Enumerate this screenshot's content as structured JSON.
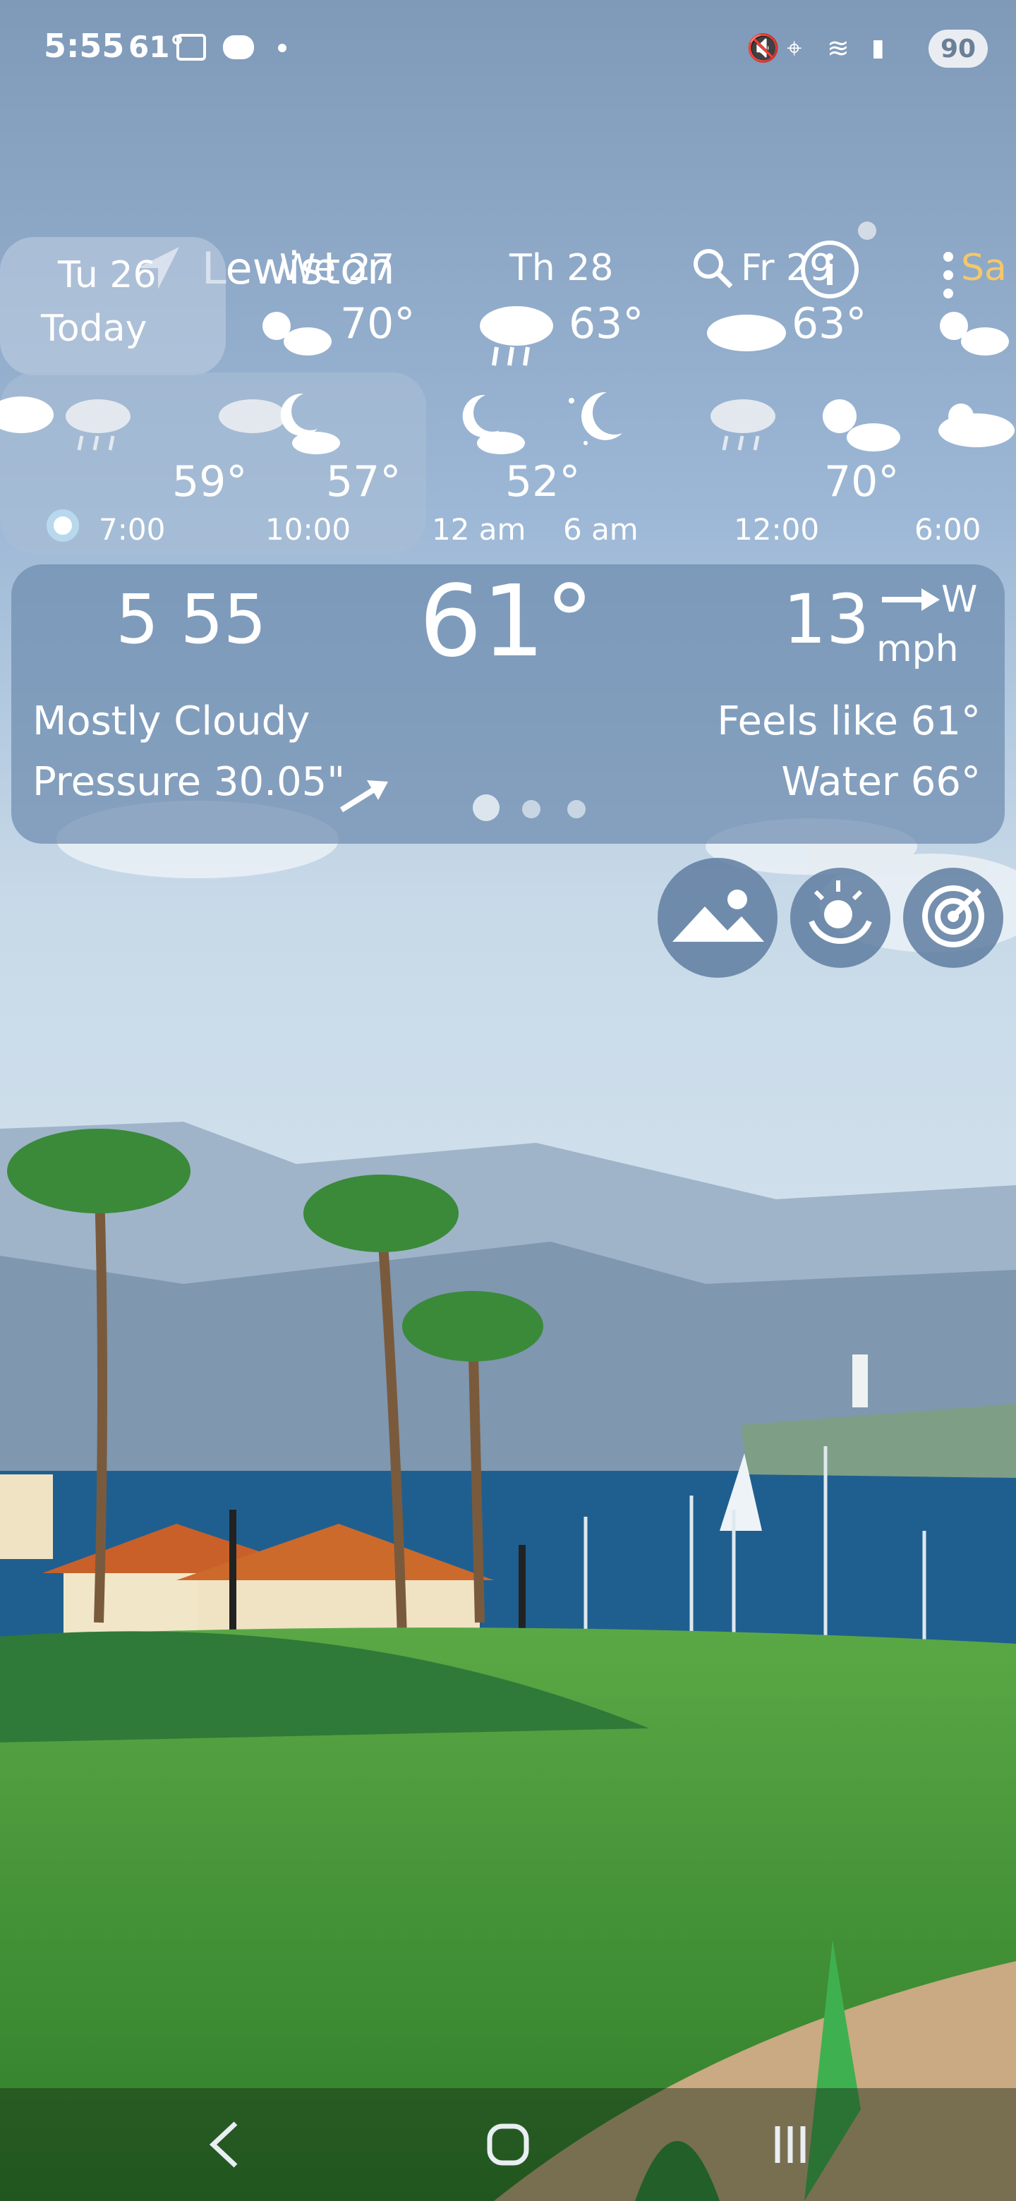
{
  "status_bar": {
    "time": "5:55",
    "temp": "61°",
    "battery": "90"
  },
  "app_bar": {
    "location": "Lewiston",
    "icons": [
      "location-arrow-icon",
      "search-icon",
      "info-icon",
      "more-vert-icon"
    ]
  },
  "daily": [
    {
      "day": "Tu 26",
      "sub": "Today",
      "temp": "",
      "icon": "none",
      "selected": true
    },
    {
      "day": "We 27",
      "temp": "70°",
      "icon": "sun-cloud-icon"
    },
    {
      "day": "Th 28",
      "temp": "63°",
      "icon": "rain-cloud-icon"
    },
    {
      "day": "Fr 29",
      "temp": "63°",
      "icon": "cloud-icon"
    },
    {
      "day": "Sa",
      "temp": "",
      "icon": "sun-cloud-icon",
      "accent": "#f4c86a"
    }
  ],
  "hourly": {
    "temps": [
      "59°",
      "57°",
      "52°",
      "70°"
    ],
    "labels": [
      "7:00",
      "10:00",
      "12 am",
      "6 am",
      "12:00",
      "6:00"
    ]
  },
  "current": {
    "time": "5 55",
    "temp": "61°",
    "wind_speed": "13",
    "wind_unit": "mph",
    "wind_dir": "W",
    "condition": "Mostly Cloudy",
    "feels_like": "Feels like 61°",
    "pressure": "Pressure 30.05\"",
    "water": "Water 66°",
    "page_dots": 3,
    "active_dot": 1
  },
  "colors": {
    "card": "#6e8caf",
    "accent_day": "#f4c86a",
    "sky": "#8faccf",
    "sea": "#1f5f8f",
    "grass": "#4f9f3a"
  }
}
